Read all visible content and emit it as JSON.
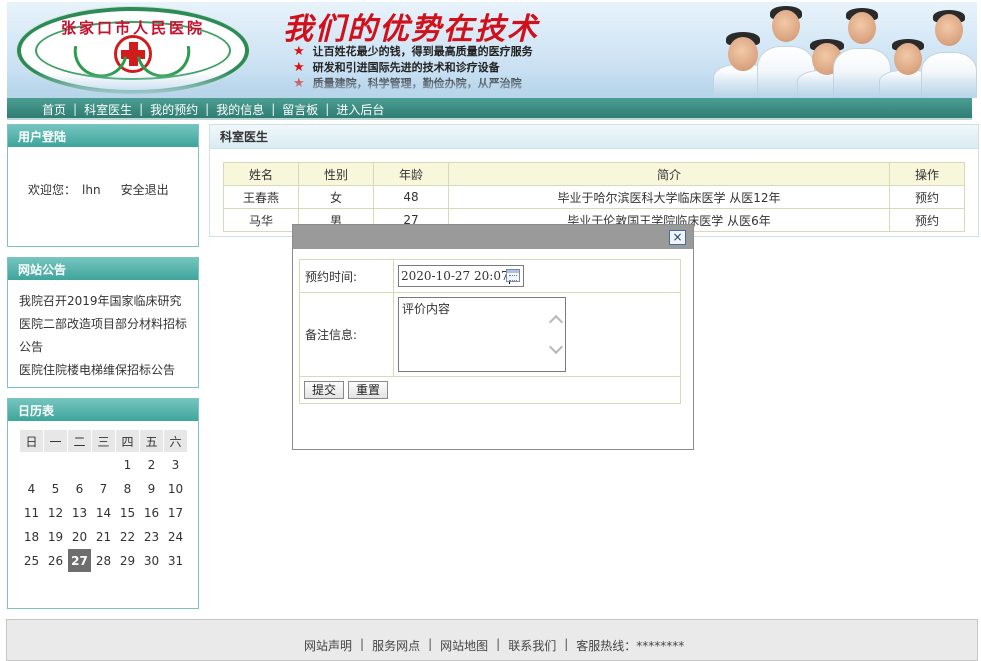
{
  "header": {
    "logo_text": "张家口市人民医院",
    "slogan": "我们的优势在技术",
    "bullets": [
      "让百姓花最少的钱，得到最高质量的医疗服务",
      "研发和引进国际先进的技术和诊疗设备",
      "质量建院，科学管理，勤俭办院，从严治院"
    ]
  },
  "nav": {
    "items": [
      "首页",
      "科室医生",
      "我的预约",
      "我的信息",
      "留言板",
      "进入后台"
    ],
    "separator": "|"
  },
  "login": {
    "title": "用户登陆",
    "welcome": "欢迎您：",
    "username": "lhn",
    "logout": "安全退出"
  },
  "notice": {
    "title": "网站公告",
    "items": [
      "我院召开2019年国家临床研究",
      "医院二部改造项目部分材料招标公告",
      "医院住院楼电梯维保招标公告"
    ]
  },
  "calendar": {
    "title": "日历表",
    "weekdays": [
      "日",
      "一",
      "二",
      "三",
      "四",
      "五",
      "六"
    ],
    "weeks": [
      [
        "",
        "",
        "",
        "",
        "1",
        "2",
        "3"
      ],
      [
        "4",
        "5",
        "6",
        "7",
        "8",
        "9",
        "10"
      ],
      [
        "11",
        "12",
        "13",
        "14",
        "15",
        "16",
        "17"
      ],
      [
        "18",
        "19",
        "20",
        "21",
        "22",
        "23",
        "24"
      ],
      [
        "25",
        "26",
        "27",
        "28",
        "29",
        "30",
        "31"
      ]
    ],
    "today": "27"
  },
  "main": {
    "title": "科室医生",
    "columns": [
      "姓名",
      "性别",
      "年龄",
      "简介",
      "操作"
    ],
    "rows": [
      [
        "王春燕",
        "女",
        "48",
        "毕业于哈尔滨医科大学临床医学 从医12年",
        "预约"
      ],
      [
        "马华",
        "男",
        "27",
        "毕业于伦敦国王学院临床医学 从医6年",
        "预约"
      ]
    ]
  },
  "modal": {
    "close_symbol": "×",
    "time_label": "预约时间:",
    "time_value": "2020-10-27 20:07",
    "note_label": "备注信息:",
    "note_value": "评价内容",
    "submit": "提交",
    "reset": "重置"
  },
  "footer": {
    "links": [
      "网站声明",
      "服务网点",
      "网站地图",
      "联系我们",
      "客服热线：********"
    ],
    "separator": "|"
  }
}
